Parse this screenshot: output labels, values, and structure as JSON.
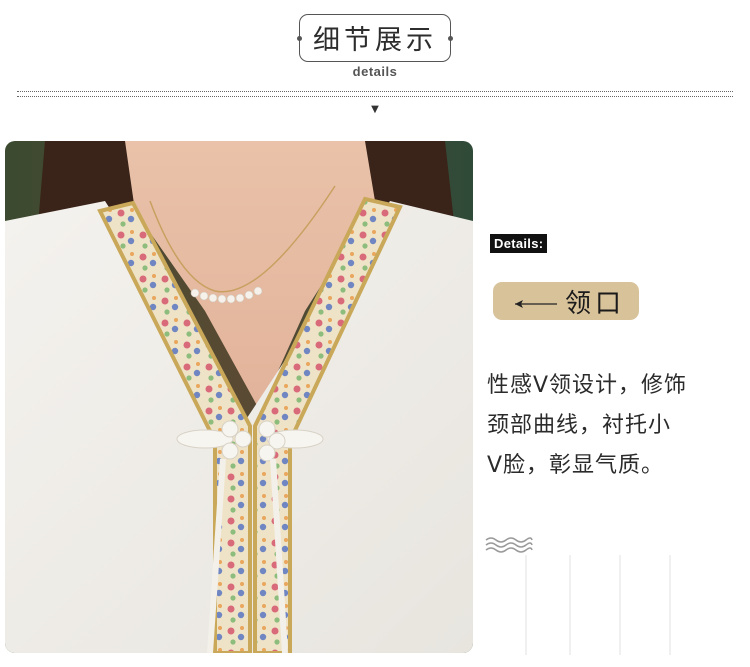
{
  "header": {
    "title": "细节展示",
    "subtitle": "details",
    "caret": "▼"
  },
  "photo": {
    "description_icon": "product-detail-photo"
  },
  "side": {
    "badge": "Details:",
    "pill_label": "领口",
    "desc_lines": [
      "性感V领设计，修饰",
      "颈部曲线，衬托小",
      "V脸，彰显气质。"
    ]
  },
  "colors": {
    "pill": "#d8c29a",
    "badge_bg": "#111111",
    "trim_gold": "#c9a85a"
  }
}
